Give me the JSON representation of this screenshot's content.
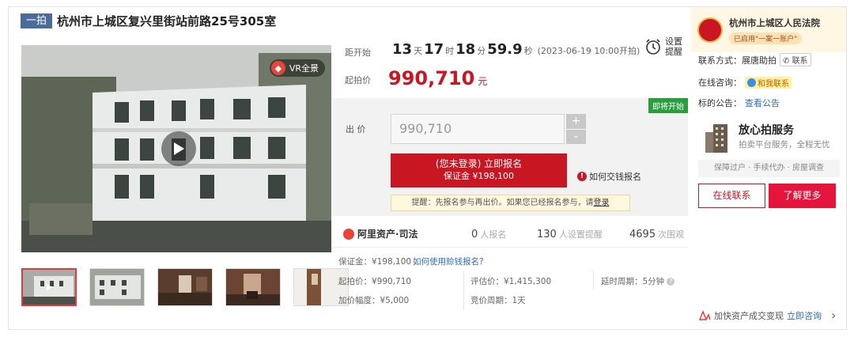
{
  "title": {
    "tag": "一拍",
    "text": "杭州市上城区复兴里街站前路25号305室"
  },
  "media": {
    "vr_label": "VR全景",
    "vr_mark": "◆"
  },
  "countdown": {
    "label": "距开始",
    "days": "13",
    "days_unit": "天",
    "hours": "17",
    "hours_unit": "时",
    "minutes": "18",
    "minutes_unit": "分",
    "seconds": "59.9",
    "seconds_unit": "秒",
    "start_note": "(2023-06-19 10:00开拍)"
  },
  "start_price": {
    "label": "起拍价",
    "value": "990,710",
    "unit": "元"
  },
  "remind": {
    "line1": "设置",
    "line2": "提醒"
  },
  "bid": {
    "badge": "即将开始",
    "label": "出 价",
    "input_value": "990,710",
    "plus": "+",
    "minus": "-",
    "signup_main": "(您未登录) 立即报名",
    "signup_sub": "保证金 ¥198,100",
    "howpay": "如何交钱报名",
    "tip_text": "提醒：先报名参与再出价。如果您已经报名参与，请",
    "tip_link": "登录"
  },
  "stats": {
    "brand": "阿里资产·司法",
    "signups": "0",
    "signups_unit": "人报名",
    "reminders": "130",
    "reminders_unit": "人设置提醒",
    "views": "4695",
    "views_unit": "次围观"
  },
  "details": {
    "deposit": "保证金：¥198,100",
    "deposit_link": "如何使用赊钱报名?",
    "start_price": "起拍价：¥990,710",
    "appraisal": "评估价：¥1,415,300",
    "delay": "延时周期：5分钟",
    "increment": "加价幅度：¥5,000",
    "cycle": "竞价周期：1天"
  },
  "sidebar": {
    "court_name": "杭州市上城区人民法院",
    "court_pill": "已启用\"一案一账户\"",
    "contact_label": "联系方式：展唐助拍",
    "contact_chip": "联系",
    "consult_label": "在线咨询：",
    "consult_chip": "和我联系",
    "notice_label": "标的公告：",
    "notice_link": "查看公告",
    "service_title": "放心拍服务",
    "service_desc": "拍卖平台服务，全程无忧",
    "service_tags": "保障过户 · 手续代办 · 房屋调查",
    "btn_online": "在线联系",
    "btn_more": "了解更多",
    "footer_text": "加快资产成交变现",
    "footer_link": "立即咨询",
    "footer_arrow": "›"
  },
  "colors": {
    "accent": "#c81623",
    "tag": "#4b6c9a",
    "green_badge": "#2a9d3e",
    "link": "#2f6cc0"
  }
}
